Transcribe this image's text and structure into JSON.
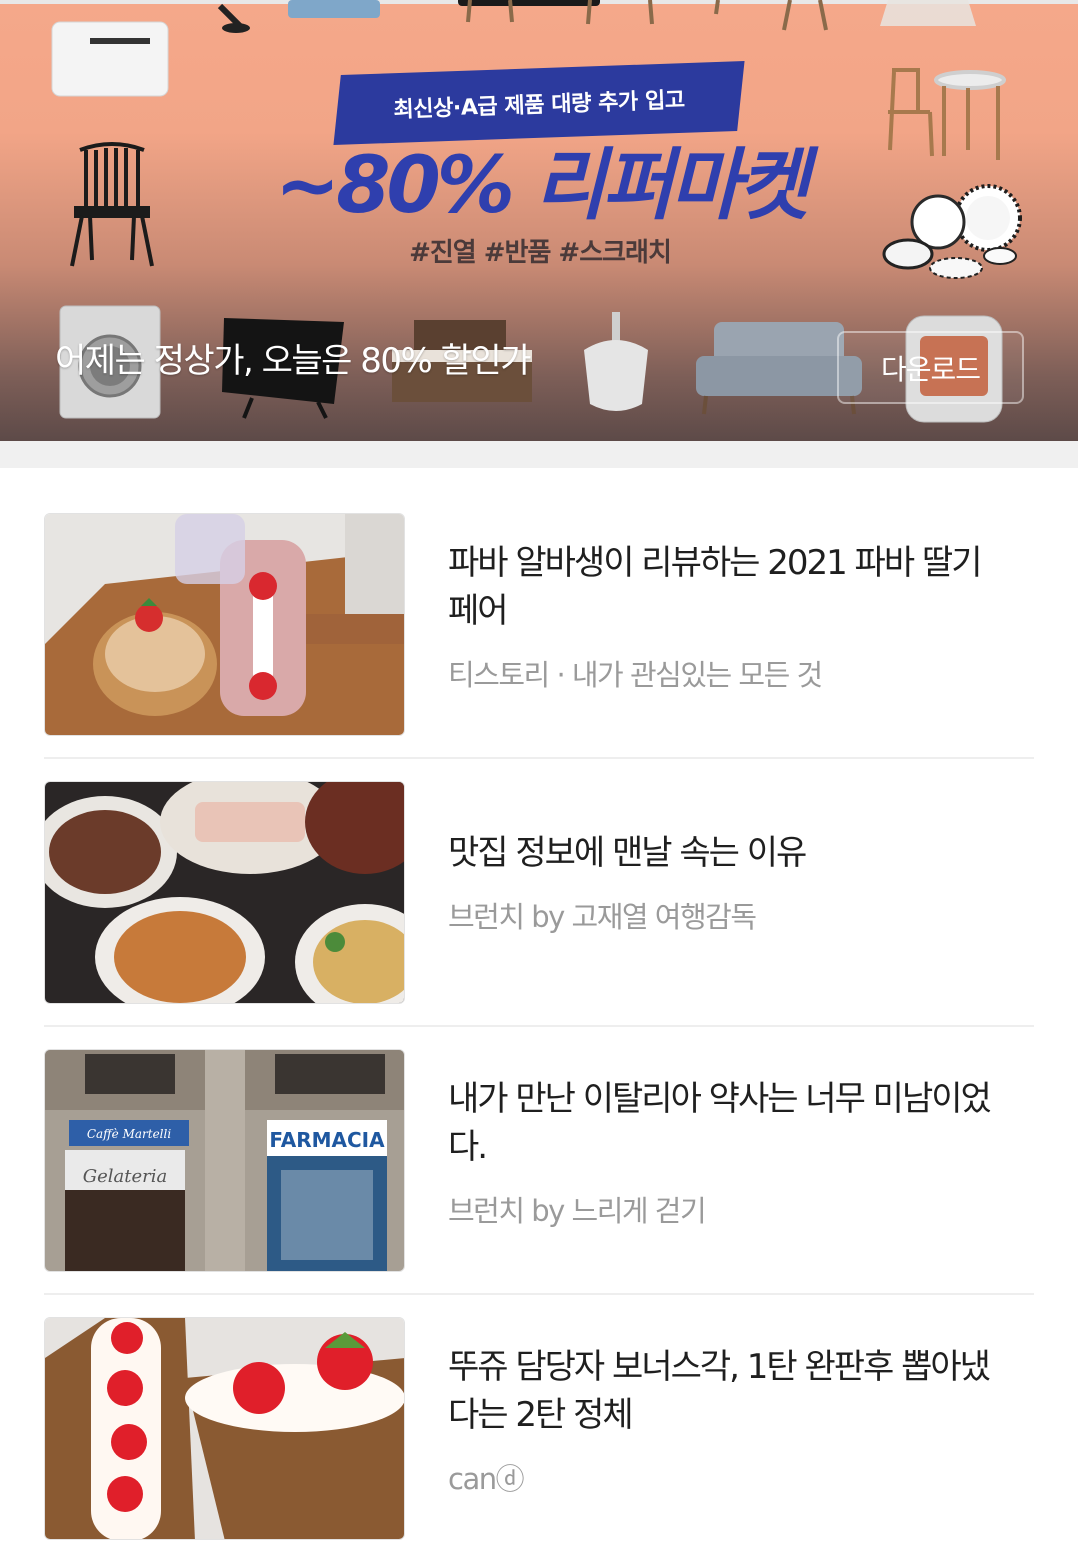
{
  "banner": {
    "ribbon_text": "최신상·A급 제품 대량 추가 입고",
    "headline": "~80% 리퍼마켓",
    "hashtags": "#진열  #반품  #스크래치",
    "caption": "어제는 정상가, 오늘은 80% 할인가",
    "download_label": "다운로드"
  },
  "articles": [
    {
      "title": "파바 알바생이 리뷰하는 2021 파바 딸기 페어",
      "source": "티스토리 · 내가 관심있는 모든 것"
    },
    {
      "title": "맛집 정보에 맨날 속는 이유",
      "source": "브런치 by 고재열 여행감독"
    },
    {
      "title": "내가 만난 이탈리아 약사는 너무 미남이었다.",
      "source": "브런치 by 느리게 걷기"
    },
    {
      "title": "뚜쥬 담당자 보너스각, 1탄 완판후 뽑아냈다는 2탄 정체",
      "source": "canⓓ"
    }
  ],
  "thumb_text": {
    "farmacia": "FARMACIA",
    "gelateria": "Gelateria",
    "cafe_sign": "Caffè Martelli"
  },
  "colors": {
    "banner_peach": "#f5a88a",
    "headline_blue": "#2f3fae",
    "title_text": "#1f1f1f",
    "source_text": "#9a9a9a"
  }
}
